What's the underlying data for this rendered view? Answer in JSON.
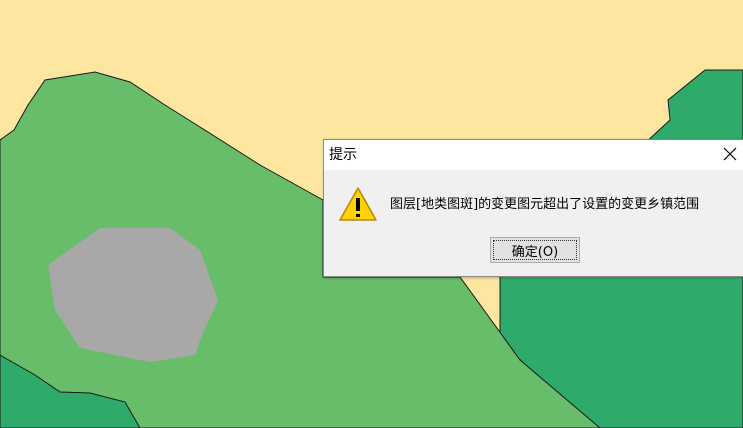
{
  "dialog": {
    "title": "提示",
    "message": "图层[地类图斑]的变更图元超出了设置的变更乡镇范围",
    "ok_label": "确定(O)",
    "icon": "warning-icon"
  },
  "colors": {
    "background_polygon": "#fde6a0",
    "light_green_polygon": "#67bd6a",
    "dark_green_polygon": "#2eab6a",
    "gray_polygon": "#a8a8a8",
    "outline": "#1a1a1a"
  }
}
